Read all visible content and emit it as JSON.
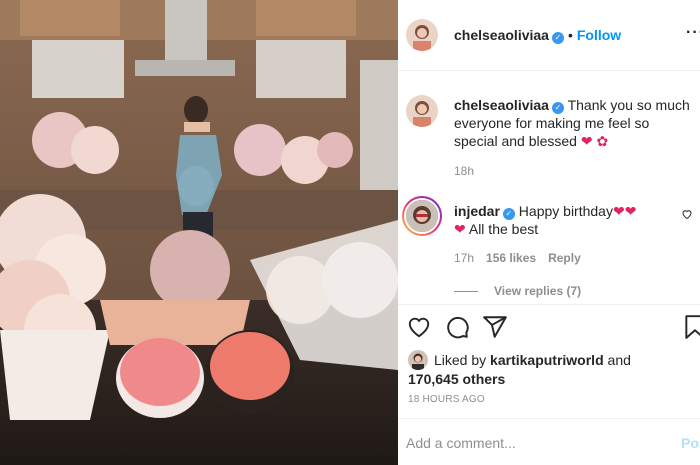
{
  "post_owner": {
    "username": "chelseaoliviaa",
    "verified_icon": "verified-badge-icon",
    "separator": "•",
    "follow_label": "Follow",
    "more_icon": "ellipsis-icon"
  },
  "caption": {
    "username": "chelseaoliviaa",
    "text": "Thank you so much everyone for making me feel so special and blessed",
    "emoji": "❤ ✿",
    "time": "18h"
  },
  "comment": {
    "username": "injedar",
    "text_before": "Happy birthday",
    "hearts": "❤❤",
    "heart2": "❤",
    "text_after": "All the best",
    "time": "17h",
    "likes": "156 likes",
    "reply_label": "Reply",
    "view_replies": "View replies (7)"
  },
  "actions": {
    "like_icon": "heart-icon",
    "comment_icon": "comment-icon",
    "share_icon": "share-icon",
    "save_icon": "bookmark-icon"
  },
  "likes": {
    "prefix": "Liked by",
    "user": "kartikaputriworld",
    "and": "and",
    "count": "170,645 others"
  },
  "post_time": "18 HOURS AGO",
  "add_comment": {
    "placeholder": "Add a comment...",
    "post_label": "Post"
  },
  "colors": {
    "link_blue": "#0095f6",
    "verified_blue": "#3897f0",
    "heart_red": "#e0245e",
    "muted_gray": "#8e8e8e"
  }
}
